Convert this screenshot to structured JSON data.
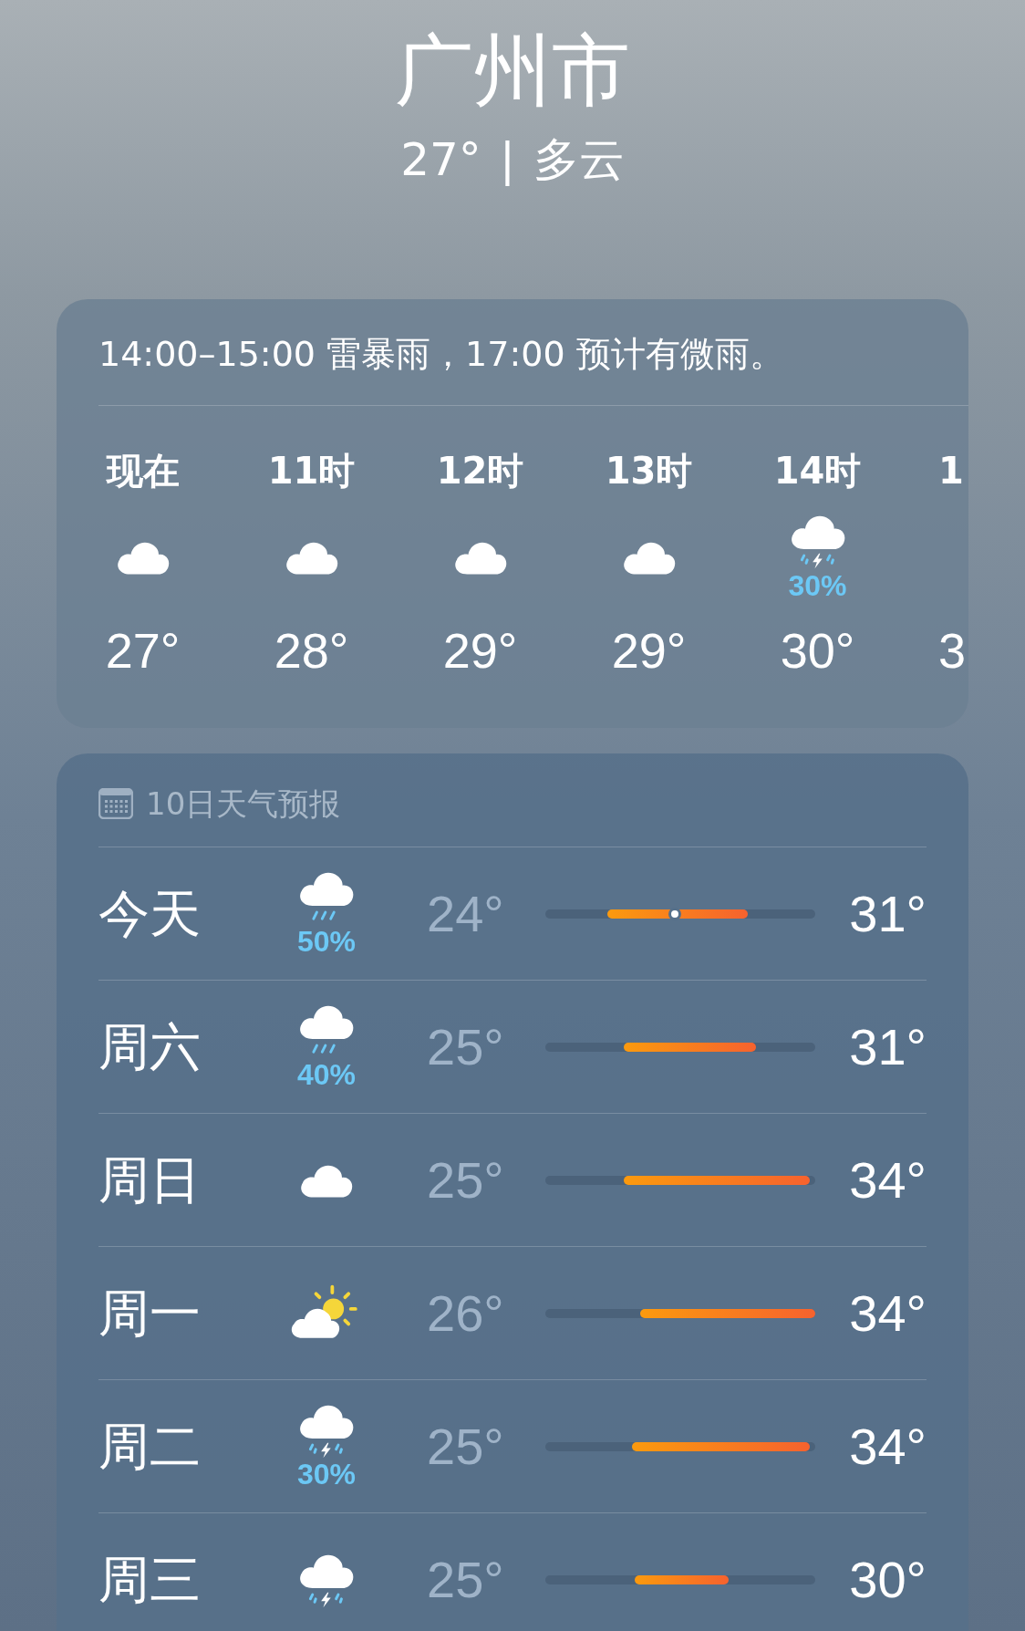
{
  "location": {
    "city": "广州市",
    "summary": "27°",
    "separator": "|",
    "condition": "多云"
  },
  "hourly": {
    "summary": "14:00–15:00 雷暴雨，17:00 预计有微雨。",
    "hours": [
      {
        "label": "现在",
        "kind": "cloud",
        "temp": "27°"
      },
      {
        "label": "11时",
        "kind": "cloud",
        "temp": "28°"
      },
      {
        "label": "12时",
        "kind": "cloud",
        "temp": "29°"
      },
      {
        "label": "13时",
        "kind": "cloud",
        "temp": "29°"
      },
      {
        "label": "14时",
        "kind": "thunder",
        "precip": "30%",
        "temp": "30°"
      },
      {
        "label": "1",
        "temp": "3"
      }
    ]
  },
  "forecast": {
    "title": "10日天气预报",
    "days": [
      {
        "day": "今天",
        "kind": "rain",
        "precip": "50%",
        "low": "24°",
        "high": "31°",
        "now_marker": {
          "level": 0.48
        }
      },
      {
        "day": "周六",
        "kind": "rain",
        "precip": "40%",
        "low": "25°",
        "high": "31°"
      },
      {
        "day": "周日",
        "kind": "cloud",
        "low": "25°",
        "high": "34°"
      },
      {
        "day": "周一",
        "kind": "partly_sunny",
        "low": "26°",
        "high": "34°"
      },
      {
        "day": "周二",
        "kind": "thunder",
        "precip": "30%",
        "low": "25°",
        "high": "34°"
      },
      {
        "day": "周三",
        "kind": "thunder",
        "low": "25°",
        "high": "30°"
      }
    ]
  }
}
